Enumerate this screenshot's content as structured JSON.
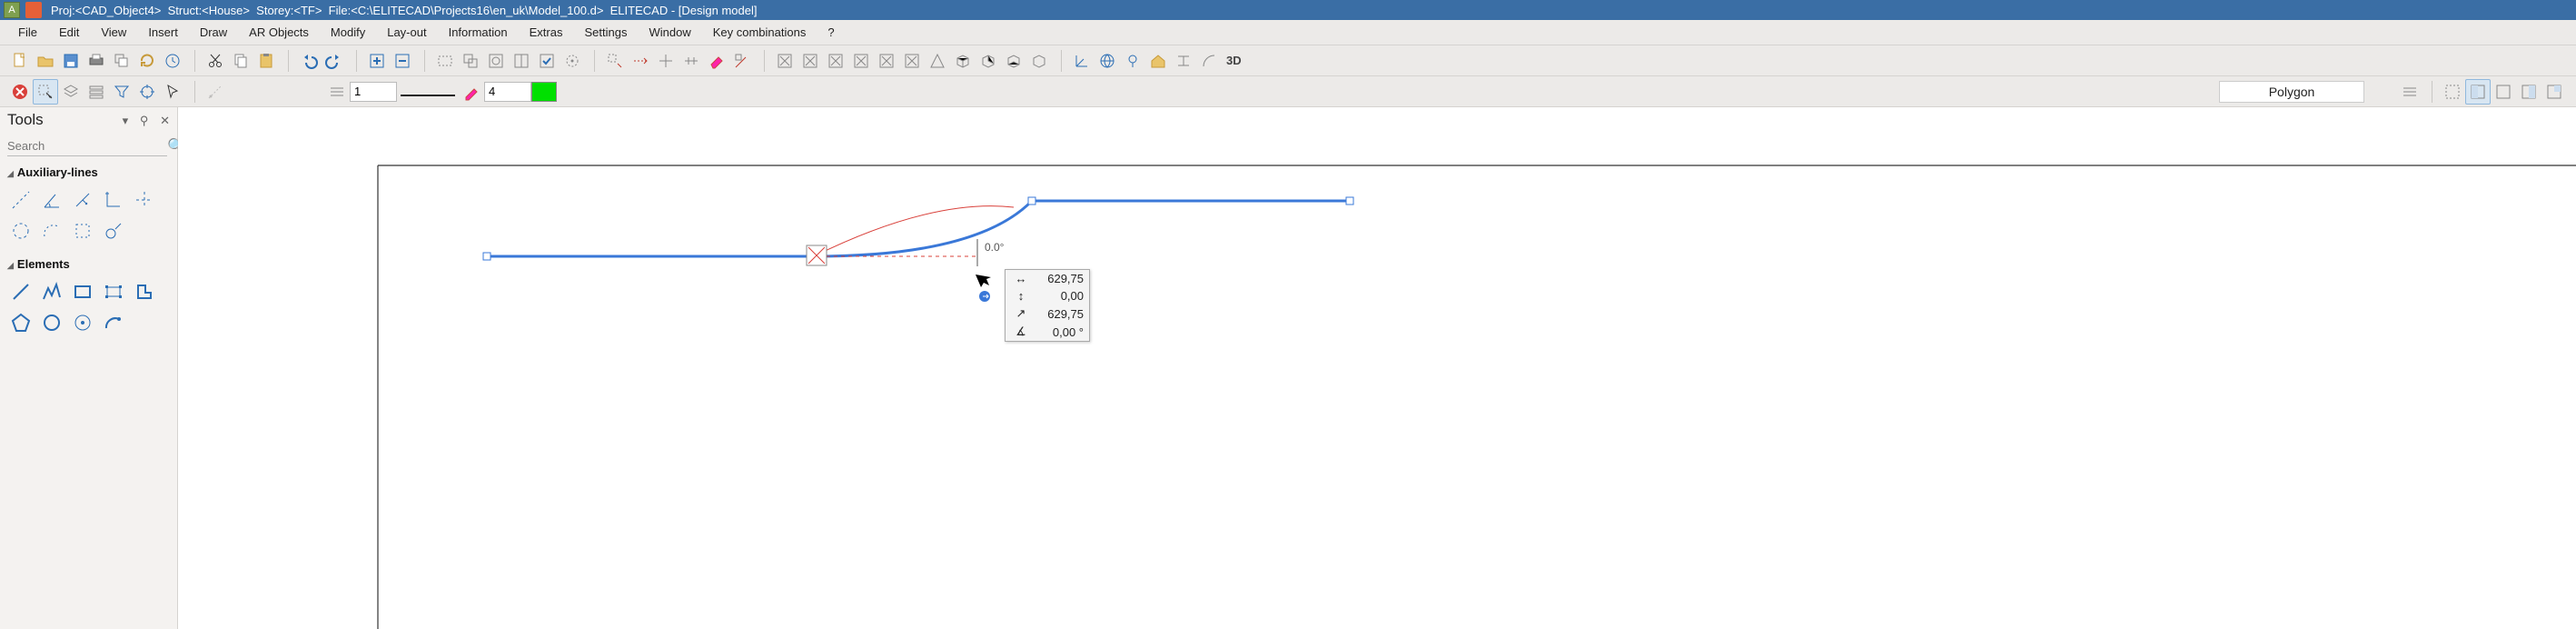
{
  "title": {
    "text": "Proj:<CAD_Object4>  Struct:<House>  Storey:<TF>  File:<C:\\ELITECAD\\Projects16\\en_uk\\Model_100.d>  ELITECAD - [Design model]"
  },
  "menu": [
    "File",
    "Edit",
    "View",
    "Insert",
    "Draw",
    "AR Objects",
    "Modify",
    "Lay-out",
    "Information",
    "Extras",
    "Settings",
    "Window",
    "Key combinations",
    "?"
  ],
  "toolbar1_icons": [
    "new-file-icon",
    "open-folder-icon",
    "save-icon",
    "print-icon",
    "copy-storey-icon",
    "reload-icon",
    "clock-icon",
    "sep",
    "cut-icon",
    "copy-icon",
    "paste-icon",
    "sep",
    "undo-icon",
    "redo-icon",
    "sep",
    "plus-box-icon",
    "minus-box-icon",
    "sep",
    "box-dash-icon",
    "double-box-icon",
    "circle-box-icon",
    "split-box-icon",
    "check-box-icon",
    "circ-target-icon",
    "sep",
    "dim-move-icon",
    "dim-arrow-icon",
    "crosshair-icon",
    "spread-icon",
    "eraser-icon",
    "pen-angle-icon",
    "sep",
    "x-box-1",
    "x-box-2",
    "x-box-3",
    "x-box-4",
    "x-box-5",
    "x-box-6",
    "triangle-up-icon",
    "cube-a-icon",
    "cube-b-icon",
    "cube-c-icon",
    "cube-d-icon",
    "sep",
    "axis-icon",
    "globe-icon",
    "pin-icon",
    "house-icon",
    "double-t-icon",
    "arc-icon",
    "3d-label"
  ],
  "toolbar2": {
    "x_delete": "close-x-icon",
    "line_num": "1",
    "pen_num": "4",
    "shape_label": "Polygon",
    "view_icons": [
      "lines-icon",
      "dashed-sel-icon",
      "layout-a-icon",
      "layout-b-icon",
      "layout-c-icon",
      "layout-d-icon"
    ]
  },
  "panel": {
    "title": "Tools",
    "search_placeholder": "Search",
    "section1": "Auxiliary-lines",
    "section1_icons": [
      "aux-diag-dash",
      "aux-angle",
      "aux-perp-arrow",
      "aux-corner",
      "aux-cross",
      "aux-circle-dash",
      "aux-arc-dots",
      "aux-square-dots",
      "aux-tangent"
    ],
    "section2": "Elements",
    "section2_icons": [
      "el-line",
      "el-polyline",
      "el-rect",
      "el-rect-handles",
      "el-l-shape",
      "el-pentagon",
      "el-circle",
      "el-target",
      "el-arc-point"
    ]
  },
  "canvas": {
    "angle_label": "0.0°"
  },
  "measurements": {
    "rows": [
      {
        "icon": "↔",
        "value": "629,75"
      },
      {
        "icon": "↕",
        "value": "0,00"
      },
      {
        "icon": "↗",
        "value": "629,75"
      },
      {
        "icon": "∠",
        "value": "0,00 °"
      }
    ]
  },
  "colors": {
    "accent": "#2a6db4",
    "green": "#00e000",
    "title_bg": "#3a6ea5"
  }
}
